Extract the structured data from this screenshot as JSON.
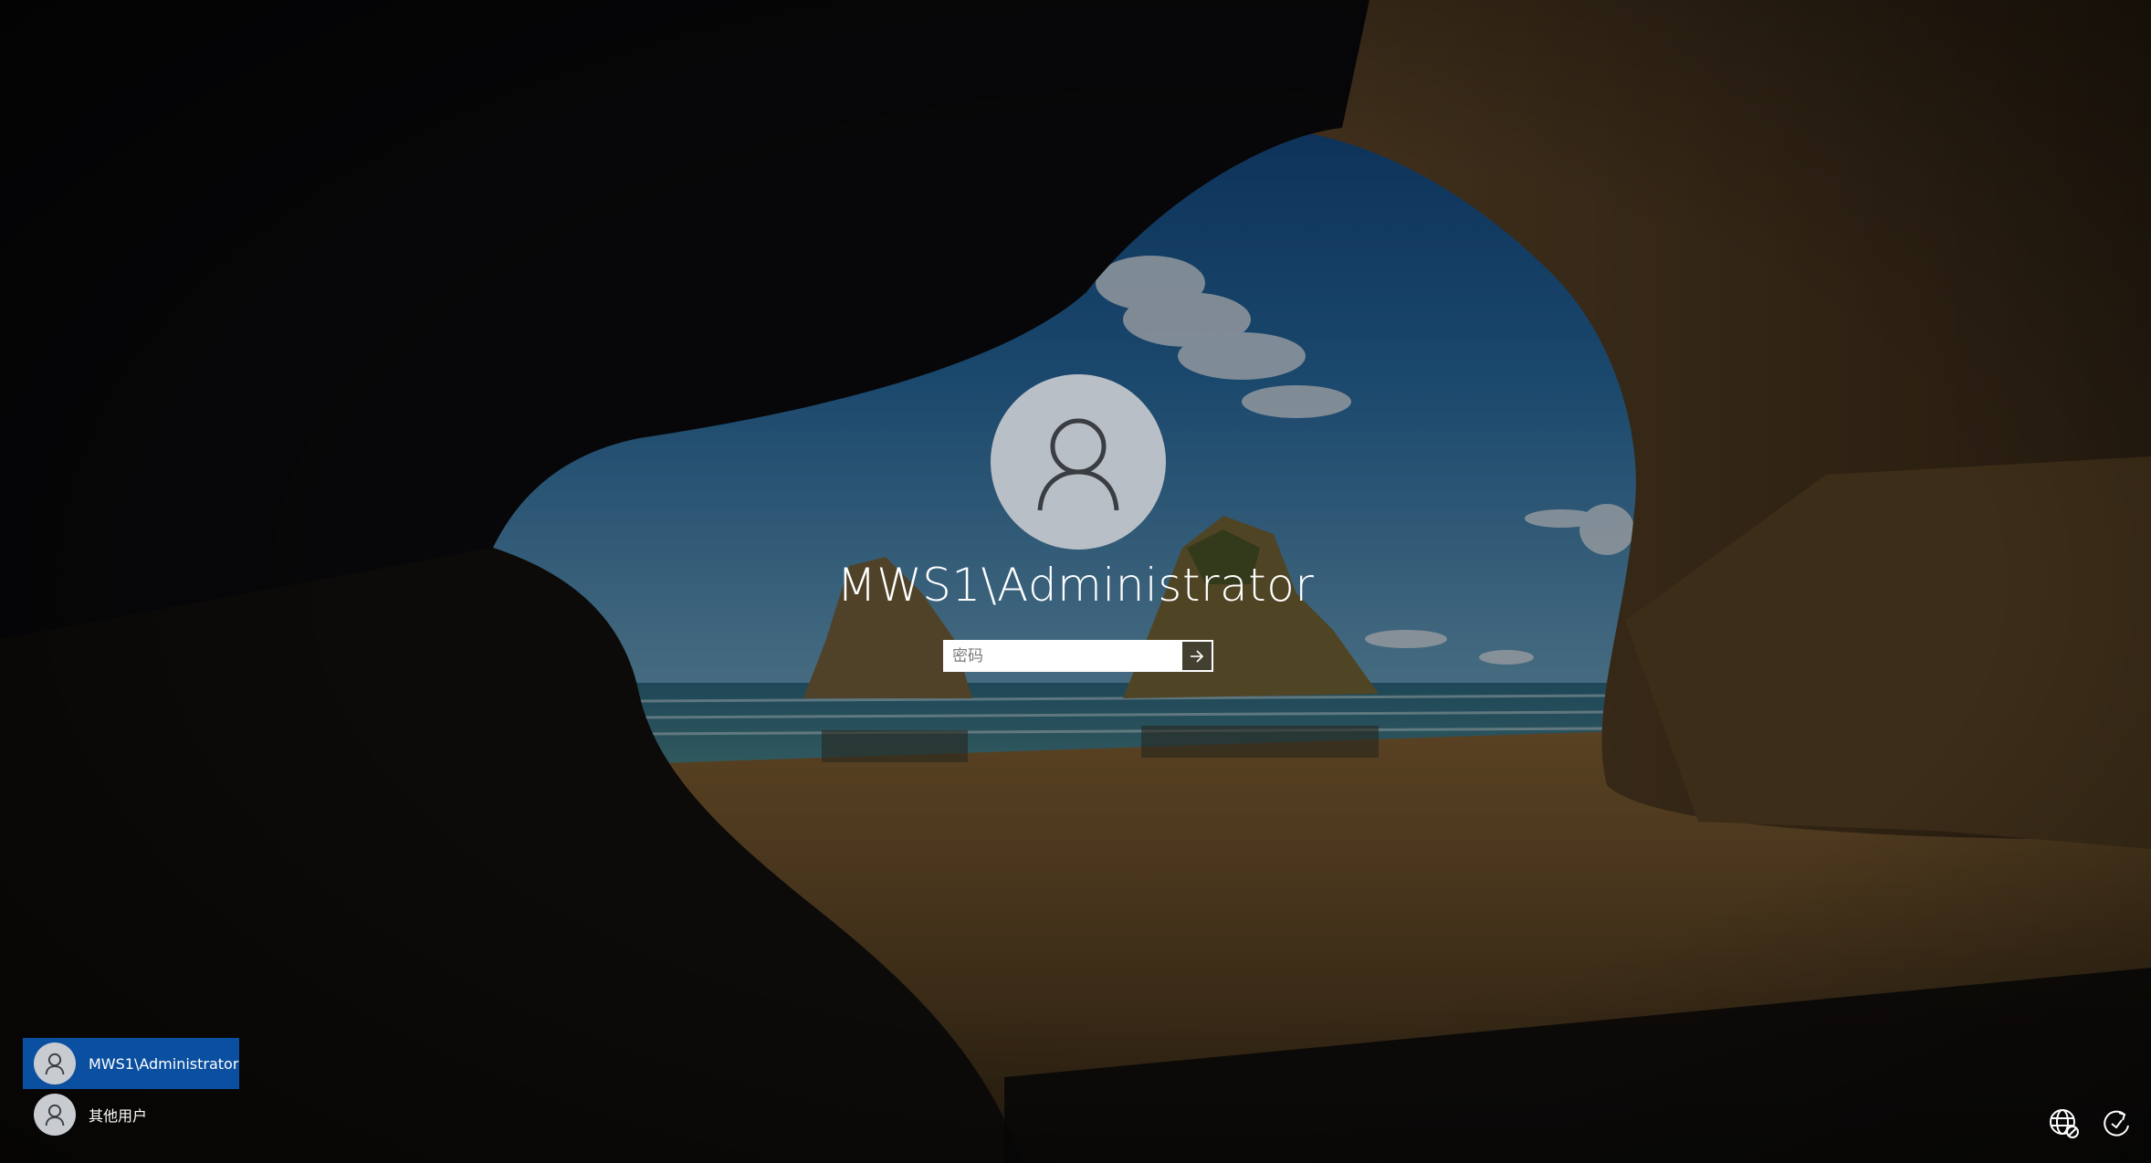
{
  "login": {
    "username": "MWS1\\Administrator",
    "password_placeholder": "密码",
    "submit_icon": "arrow-right-icon",
    "avatar_icon": "user-icon"
  },
  "user_list": [
    {
      "name": "MWS1\\Administrator",
      "selected": true,
      "icon": "user-icon"
    },
    {
      "name": "其他用户",
      "selected": false,
      "icon": "user-icon"
    }
  ],
  "system_icons": [
    {
      "name": "network-icon"
    },
    {
      "name": "ease-of-access-icon"
    }
  ],
  "colors": {
    "selected_user_bg": "#0b4fa0",
    "avatar_bg": "#b9bfc6",
    "text": "#ffffff"
  }
}
